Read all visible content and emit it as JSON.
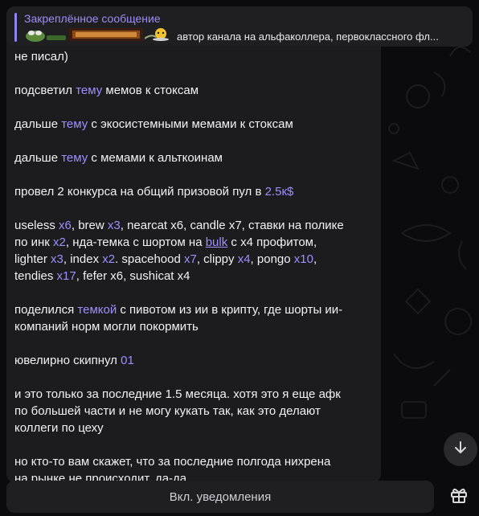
{
  "pinned": {
    "title": "Закреплённое сообщение",
    "preview_text": "автор канала на альфаколлера, первоклассного фл..."
  },
  "message": {
    "lines": [
      {
        "parts": [
          {
            "t": "не писал)"
          }
        ]
      },
      {
        "gap": true
      },
      {
        "parts": [
          {
            "t": "подсветил "
          },
          {
            "t": "тему",
            "a": 1
          },
          {
            "t": " мемов к стоксам"
          }
        ]
      },
      {
        "gap": true
      },
      {
        "parts": [
          {
            "t": "дальше "
          },
          {
            "t": "тему",
            "a": 1
          },
          {
            "t": " с экосистемными мемами к стоксам"
          }
        ]
      },
      {
        "gap": true
      },
      {
        "parts": [
          {
            "t": "дальше "
          },
          {
            "t": "тему",
            "a": 1
          },
          {
            "t": " с мемами к альткоинам"
          }
        ]
      },
      {
        "gap": true
      },
      {
        "parts": [
          {
            "t": "провел 2 конкурса на общий призовой пул в "
          },
          {
            "t": "2.5к$",
            "a": 1
          }
        ]
      },
      {
        "gap": true
      },
      {
        "parts": [
          {
            "t": "useless "
          },
          {
            "t": "x6",
            "a": 1
          },
          {
            "t": ", brew "
          },
          {
            "t": "x3",
            "a": 1
          },
          {
            "t": ", nearcat x6, candle x7, ставки на полике"
          }
        ]
      },
      {
        "parts": [
          {
            "t": "по инк "
          },
          {
            "t": "x2",
            "a": 1
          },
          {
            "t": ", нда-темка с шортом на "
          },
          {
            "t": "bulk",
            "a": 2
          },
          {
            "t": " с x4 профитом,"
          }
        ]
      },
      {
        "parts": [
          {
            "t": "lighter "
          },
          {
            "t": "x3",
            "a": 1
          },
          {
            "t": ", index "
          },
          {
            "t": "x2",
            "a": 1
          },
          {
            "t": ". spacehood "
          },
          {
            "t": "x7",
            "a": 1
          },
          {
            "t": ", clippy "
          },
          {
            "t": "x4",
            "a": 1
          },
          {
            "t": ", pongo "
          },
          {
            "t": "x10",
            "a": 1
          },
          {
            "t": ","
          }
        ]
      },
      {
        "parts": [
          {
            "t": "tendies "
          },
          {
            "t": "x17",
            "a": 1
          },
          {
            "t": ", fefer x6, sushicat x4"
          }
        ]
      },
      {
        "gap": true
      },
      {
        "parts": [
          {
            "t": "поделился "
          },
          {
            "t": "темкой",
            "a": 1
          },
          {
            "t": " с пивотом из ии в крипту, где шорты ии-"
          }
        ]
      },
      {
        "parts": [
          {
            "t": "компаний норм могли покормить"
          }
        ]
      },
      {
        "gap": true
      },
      {
        "parts": [
          {
            "t": "ювелирно скипнул "
          },
          {
            "t": "01",
            "a": 1
          }
        ]
      },
      {
        "gap": true
      },
      {
        "parts": [
          {
            "t": "и это только за последние 1.5 месяца. хотя это я еще афк"
          }
        ]
      },
      {
        "parts": [
          {
            "t": "по большей части и не могу кукать так, как это делают"
          }
        ]
      },
      {
        "parts": [
          {
            "t": "коллеги по цеху"
          }
        ]
      },
      {
        "gap": true
      },
      {
        "parts": [
          {
            "t": "но кто-то вам скажет, что за последние полгода нихрена"
          }
        ]
      },
      {
        "parts": [
          {
            "t": "на рынке не происходит. да-да"
          }
        ]
      }
    ]
  },
  "bottom": {
    "notify_label": "Вкл. уведомления"
  },
  "icons": {
    "scroll_down": "chevron-down-icon",
    "gift": "gift-icon"
  },
  "colors": {
    "accent": "#9d90ff",
    "pinned_title": "#9a8ff5",
    "bubble": "#1c1c1e",
    "panel": "#1f1f22"
  }
}
